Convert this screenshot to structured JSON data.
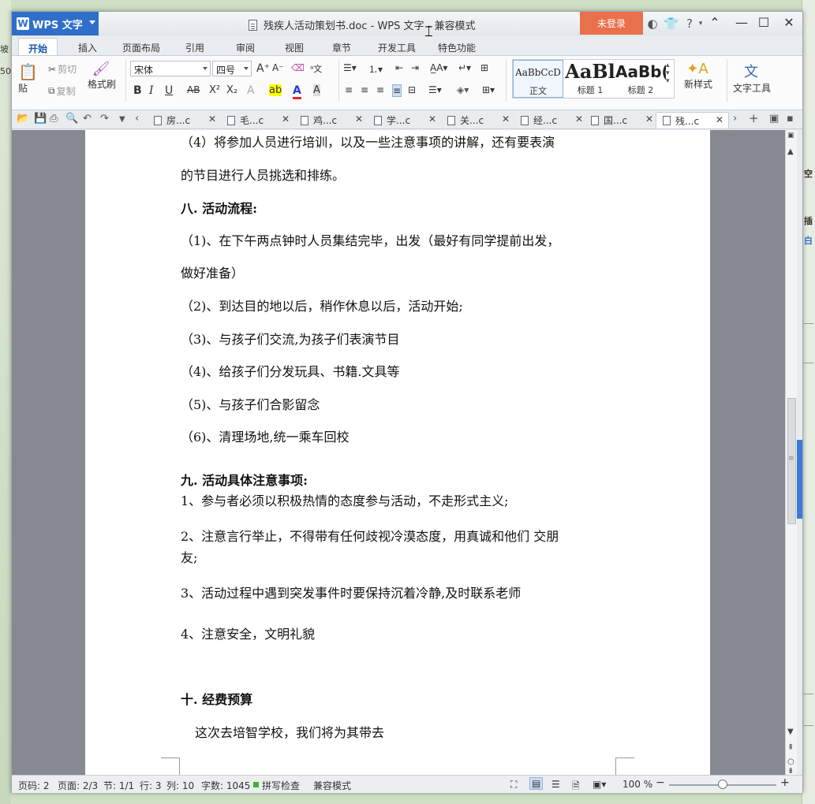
{
  "app": {
    "name": "WPS 文字",
    "doc_title": "残疾人活动策划书.doc - WPS 文字 - 兼容模式",
    "login": "未登录"
  },
  "ribbon_tabs": [
    "开始",
    "插入",
    "页面布局",
    "引用",
    "审阅",
    "视图",
    "章节",
    "开发工具",
    "特色功能"
  ],
  "ribbon": {
    "paste": "贴",
    "cut": "剪切",
    "copy": "复制",
    "format_painter": "格式刷",
    "font_name": "宋体",
    "font_size": "四号",
    "styles": [
      {
        "sample": "AaBbCcD",
        "label": "正文"
      },
      {
        "sample": "AaBl",
        "label": "标题 1"
      },
      {
        "sample": "AaBb(",
        "label": "标题 2"
      }
    ],
    "new_style": "新样式",
    "text_tools": "文字工具"
  },
  "doc_tabs": [
    "房...c",
    "毛...c",
    "鸡...c",
    "学...c",
    "关...c",
    "经...c",
    "国...c",
    "残...c"
  ],
  "document": {
    "lines": [
      "（4）将参加人员进行培训，以及一些注意事项的讲解，还有要表演",
      "的节目进行人员挑选和排练。",
      "八. 活动流程:",
      "（1)、在下午两点钟时人员集结完毕，出发（最好有同学提前出发，",
      "做好准备）",
      "（2)、到达目的地以后，稍作休息以后，活动开始;",
      "（3)、与孩子们交流,为孩子们表演节目",
      "（4)、给孩子们分发玩具、书籍.文具等",
      "（5)、与孩子们合影留念",
      "（6)、清理场地,统一乘车回校",
      "九. 活动具体注意事项:",
      "1、参与者必须以积极热情的态度参与活动，不走形式主义;",
      "2、注意言行举止，不得带有任何歧视冷漠态度，用真诚和他们 交朋",
      "友;",
      "3、活动过程中遇到突发事件时要保持沉着冷静,及时联系老师",
      "4、注意安全，文明礼貌",
      "十. 经费预算",
      "这次去培智学校，我们将为其带去"
    ]
  },
  "status": {
    "page_code": "页码: 2",
    "page": "页面: 2/3",
    "section": "节: 1/1",
    "row": "行: 3",
    "col": "列: 10",
    "word_count": "字数: 1045",
    "spell": "拼写检查",
    "compat": "兼容模式",
    "zoom": "100 %"
  },
  "background": {
    "left": [
      "坡",
      "50"
    ],
    "right": [
      "空",
      "插",
      "白"
    ]
  }
}
